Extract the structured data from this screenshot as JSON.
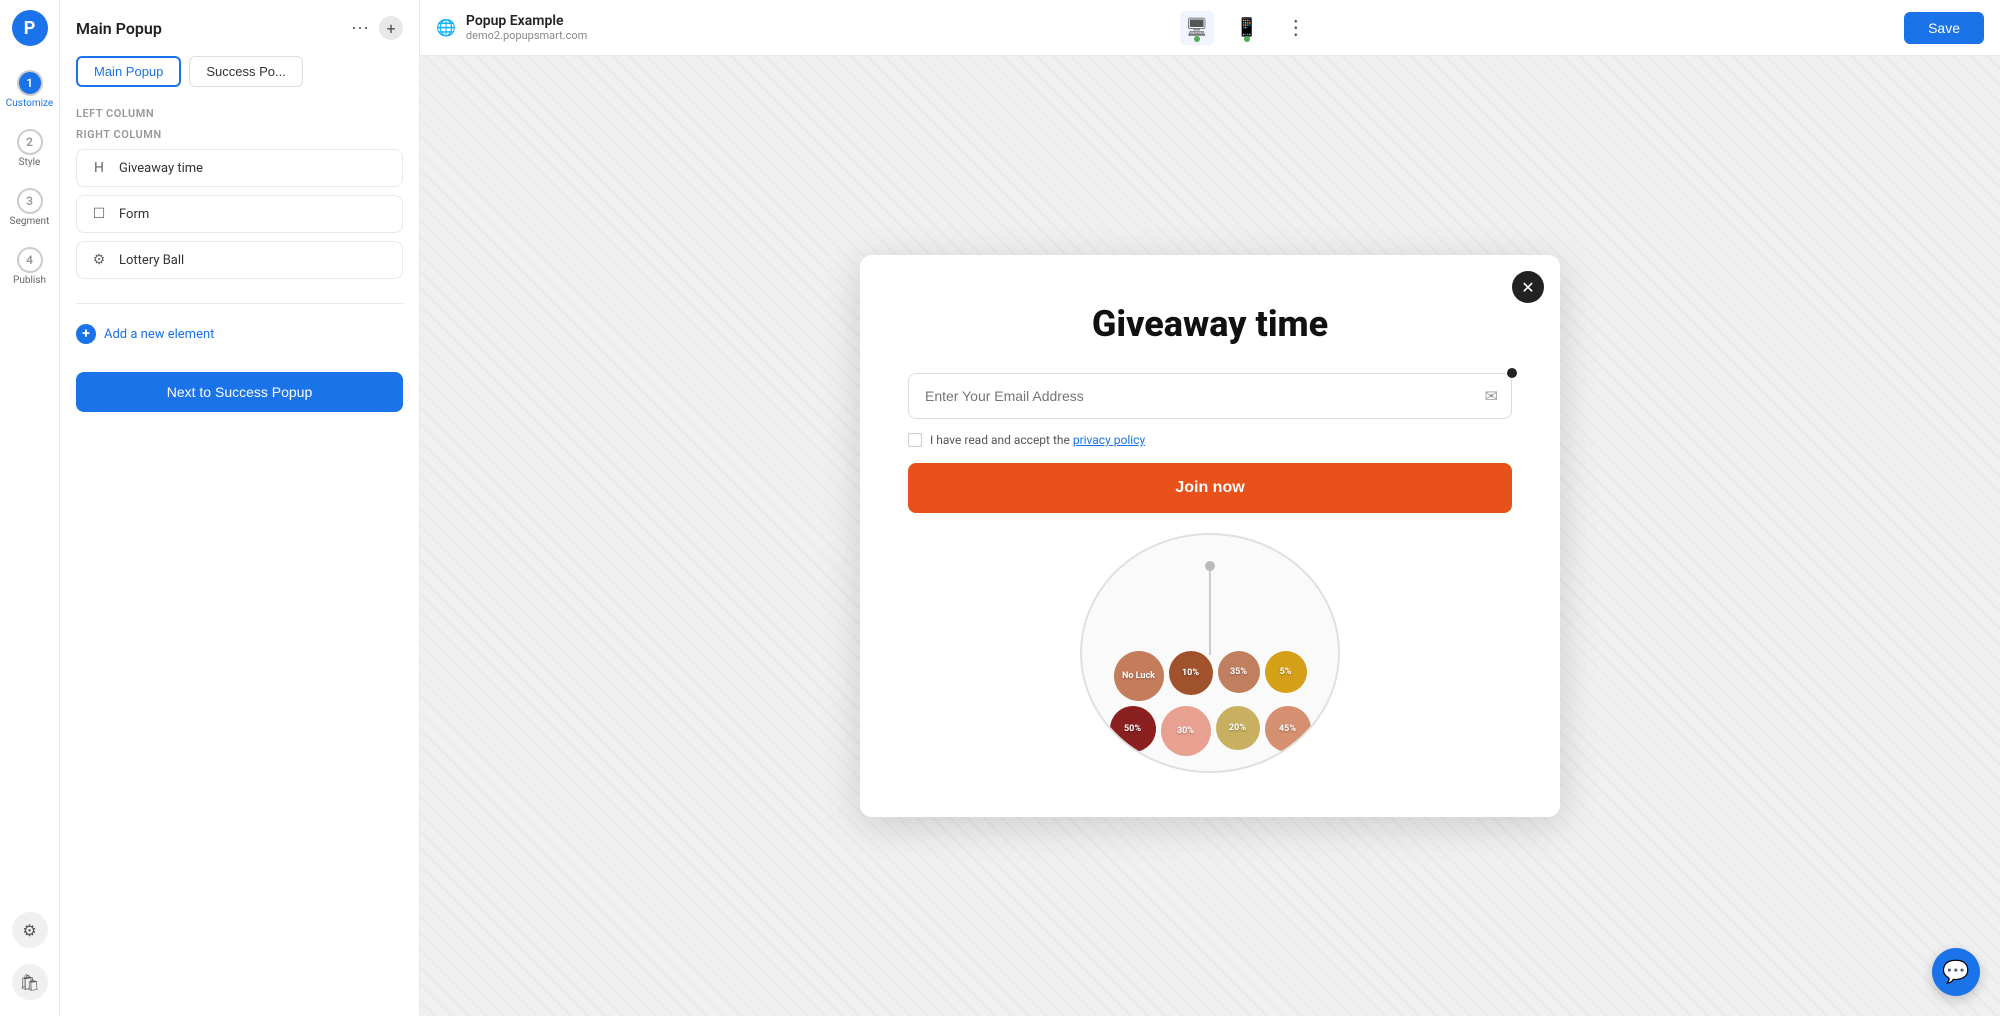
{
  "app": {
    "logo_text": "P",
    "title": "Popup Example",
    "site_url": "demo2.popupsmart.com"
  },
  "nav": {
    "steps": [
      {
        "id": "1",
        "label": "Customize",
        "active": true
      },
      {
        "id": "2",
        "label": "Style",
        "active": false
      },
      {
        "id": "3",
        "label": "Segment",
        "active": false
      },
      {
        "id": "4",
        "label": "Publish",
        "active": false
      }
    ],
    "settings_label": "Settings"
  },
  "sidebar": {
    "title": "Main Popup",
    "tabs": [
      {
        "id": "main",
        "label": "Main Popup",
        "active": true
      },
      {
        "id": "success",
        "label": "Success Po...",
        "active": false
      }
    ],
    "left_column_label": "LEFT COLUMN",
    "right_column_label": "RIGHT COLUMN",
    "elements": [
      {
        "id": "giveaway",
        "icon": "H",
        "name": "Giveaway time"
      },
      {
        "id": "form",
        "icon": "☐",
        "name": "Form"
      },
      {
        "id": "lottery",
        "icon": "⚙",
        "name": "Lottery Ball"
      }
    ],
    "add_element_label": "Add a new element",
    "next_button_label": "Next to Success Popup"
  },
  "toolbar": {
    "device_desktop": "🖥",
    "device_mobile": "📱",
    "more_options": "⋮",
    "save_label": "Save"
  },
  "popup": {
    "close_icon": "✕",
    "title": "Giveaway time",
    "email_placeholder": "Enter Your Email Address",
    "email_icon": "✉",
    "checkbox_label": "I have read and accept the ",
    "privacy_policy_link": "privacy policy",
    "join_button_label": "Join now",
    "lottery_balls": [
      {
        "label": "No Luck",
        "color": "#c47c5a",
        "size": 50
      },
      {
        "label": "10%",
        "color": "#a0522d",
        "size": 46
      },
      {
        "label": "35%",
        "color": "#c0735a",
        "size": 44
      },
      {
        "label": "5%",
        "color": "#d4a017",
        "size": 42
      },
      {
        "label": "50%",
        "color": "#8b0000",
        "size": 46
      },
      {
        "label": "30%",
        "color": "#e8a090",
        "size": 50
      },
      {
        "label": "20%",
        "color": "#c8b060",
        "size": 44
      },
      {
        "label": "45%",
        "color": "#d4956a",
        "size": 46
      }
    ]
  },
  "chat": {
    "icon": "💬"
  }
}
